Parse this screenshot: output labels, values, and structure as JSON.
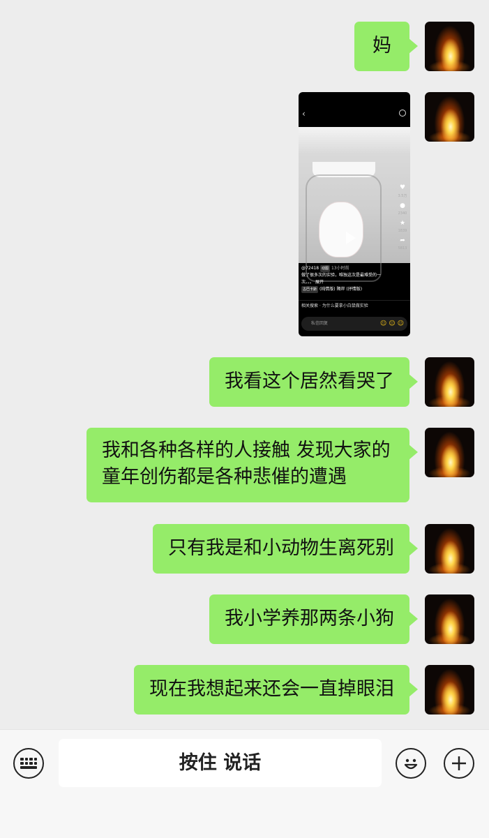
{
  "messages": [
    {
      "text": "妈"
    },
    {
      "text": "我看这个居然看哭了"
    },
    {
      "text": "我和各种各样的人接触 发现大家的童年创伤都是各种悲催的遭遇"
    },
    {
      "text": "只有我是和小动物生离死别"
    },
    {
      "text": "我小学养那两条小狗"
    },
    {
      "text": "现在我想起来还会一直掉眼泪"
    }
  ],
  "shared_image": {
    "author": "@72418",
    "author_badge": "动图",
    "time": "13小时前",
    "caption": "做了很多次的实验，唯独这次是最难受的一次。。。",
    "expand": "展开",
    "music_tag": "古巴卡斯",
    "music_text": "(纯情版)  隔岸 (抒情版)",
    "like_count": "3.5万",
    "comment_count": "2340",
    "fav_count": "1839",
    "share_count": "5813",
    "related_search": "相关搜索 · 为什么要拿小白鼠做实验",
    "reply_placeholder": "私信回复"
  },
  "input_bar": {
    "hold_to_talk": "按住 说话"
  },
  "colors": {
    "bubble": "#95ec69",
    "background": "#ededed"
  }
}
